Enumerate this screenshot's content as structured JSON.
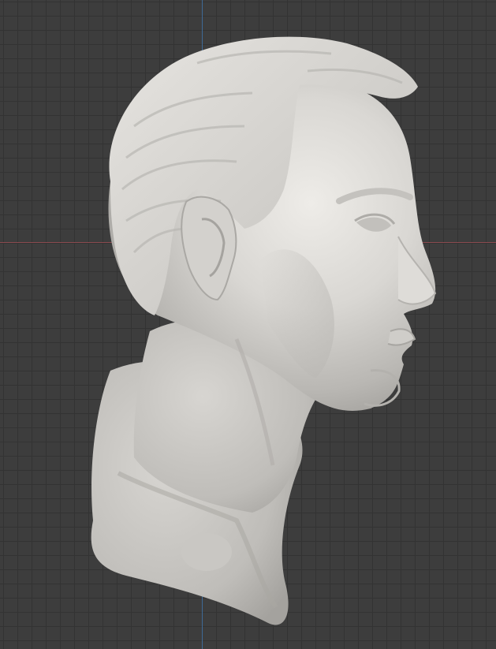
{
  "viewport": {
    "mode": "sculpt-viewport",
    "background_color": "#3d3d3d",
    "grid_color": "#333333",
    "x_axis_color": "#8b4a4f",
    "z_axis_color": "#3f6a96"
  },
  "model": {
    "subject": "sculpted-head-bust-profile",
    "material_color": "#d6d4d0"
  }
}
